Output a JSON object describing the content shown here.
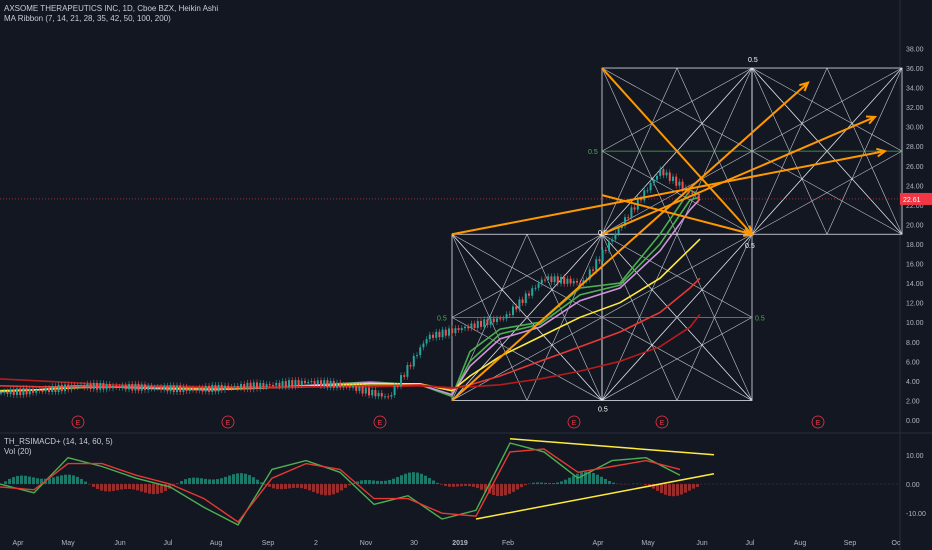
{
  "header": {
    "symbol_line": "AXSOME THERAPEUTICS INC, 1D, Cboe BZX, Heikin Ashi",
    "indicator_line": "MA Ribbon (7, 14, 21, 28, 35, 42, 50, 100, 200)"
  },
  "lower_pane": {
    "indicator_line": "TH_RSIMACD+ (14, 14, 60, 5)",
    "volume_line": "Vol (20)"
  },
  "chart_data": [
    {
      "type": "line",
      "title": "AXSOME THERAPEUTICS INC, 1D, Cboe BZX, Heikin Ashi",
      "chart_style": "candlestick (Heikin Ashi)",
      "scale": "linear",
      "grid": false,
      "background_color": "#131722",
      "ylim": [
        0,
        38
      ],
      "y_ticks": [
        "38.00",
        "36.00",
        "34.00",
        "32.00",
        "30.00",
        "28.00",
        "26.00",
        "24.00",
        "22.00",
        "20.00",
        "18.00",
        "16.00",
        "14.00",
        "12.00",
        "10.00",
        "8.00",
        "6.00",
        "4.00",
        "2.00",
        "0.00"
      ],
      "x_ticks": [
        "Apr",
        "May",
        "Jun",
        "Jul",
        "Aug",
        "Sep",
        "2",
        "Nov",
        "30",
        "2019",
        "Feb",
        "Apr",
        "May",
        "Jun",
        "Jul",
        "Aug",
        "Sep",
        "Oc"
      ],
      "last_price": {
        "label": "22.61",
        "value": 22.61,
        "color": "#f23645"
      },
      "earnings_markers": {
        "label": "E",
        "x": [
          "May",
          "Aug",
          "Nov",
          "Apr",
          "May",
          "Sep"
        ]
      },
      "price_path": [
        {
          "x": "Mar",
          "y": 2.8
        },
        {
          "x": "Apr",
          "y": 3.0
        },
        {
          "x": "May",
          "y": 3.5
        },
        {
          "x": "Jun",
          "y": 3.4
        },
        {
          "x": "Jul",
          "y": 3.3
        },
        {
          "x": "Aug",
          "y": 3.1
        },
        {
          "x": "Sep",
          "y": 3.4
        },
        {
          "x": "Oct",
          "y": 3.6
        },
        {
          "x": "Nov",
          "y": 3.9
        },
        {
          "x": "Dec",
          "y": 3.4
        },
        {
          "x": "2019",
          "y": 2.3
        },
        {
          "x": "Jan",
          "y": 8.5
        },
        {
          "x": "Feb",
          "y": 9.5
        },
        {
          "x": "Mar",
          "y": 10.5
        },
        {
          "x": "Mar",
          "y": 14.5
        },
        {
          "x": "Apr",
          "y": 14.0
        },
        {
          "x": "May",
          "y": 20.0
        },
        {
          "x": "May",
          "y": 25.5
        },
        {
          "x": "Jun",
          "y": 22.6
        }
      ],
      "series": [
        {
          "period": 7,
          "color": "#4caf50",
          "values": [
            2.9,
            3.1,
            3.5,
            3.4,
            3.2,
            3.1,
            3.3,
            3.6,
            3.9,
            3.6,
            2.4,
            7.0,
            9.3,
            10.0,
            13.5,
            14.0,
            19.0,
            23.5,
            23.0
          ]
        },
        {
          "period": 14,
          "color": "#4caf50",
          "values": [
            2.9,
            3.1,
            3.5,
            3.4,
            3.2,
            3.1,
            3.3,
            3.6,
            3.8,
            3.6,
            2.5,
            6.0,
            8.8,
            9.8,
            12.8,
            13.8,
            18.0,
            22.5,
            22.8
          ]
        },
        {
          "period": 21,
          "color": "#ce93d8",
          "values": [
            2.9,
            3.1,
            3.4,
            3.4,
            3.2,
            3.1,
            3.3,
            3.6,
            3.8,
            3.6,
            2.6,
            5.5,
            8.3,
            9.5,
            12.2,
            13.5,
            17.3,
            21.5,
            22.6
          ]
        },
        {
          "period": 50,
          "color": "#ffeb3b",
          "values": [
            3.0,
            3.1,
            3.3,
            3.4,
            3.3,
            3.2,
            3.3,
            3.5,
            3.7,
            3.7,
            3.0,
            4.5,
            6.5,
            8.5,
            10.5,
            12.0,
            14.5,
            17.5,
            18.5
          ]
        },
        {
          "period": 100,
          "color": "#e53935",
          "values": [
            3.5,
            3.4,
            3.4,
            3.4,
            3.4,
            3.3,
            3.3,
            3.4,
            3.5,
            3.6,
            3.2,
            3.6,
            4.5,
            6.0,
            7.5,
            9.0,
            11.0,
            13.5,
            14.5
          ]
        },
        {
          "period": 200,
          "color": "#b71c1c",
          "values": [
            4.2,
            4.0,
            3.8,
            3.6,
            3.5,
            3.4,
            3.4,
            3.4,
            3.4,
            3.5,
            3.3,
            3.4,
            3.6,
            4.2,
            5.0,
            6.0,
            7.5,
            9.5,
            10.8
          ]
        }
      ],
      "annotations": {
        "grid_midline_label": "0.5",
        "lower_box_price_range": [
          2.0,
          19.0
        ],
        "upper_box_price_range": [
          19.0,
          36.0
        ],
        "midlines": [
          10.5,
          27.5
        ],
        "arrow_color": "#ff9800"
      }
    },
    {
      "type": "bar",
      "title": "TH_RSIMACD+ (14, 14, 60, 5)",
      "ylim": [
        -14,
        15
      ],
      "y_ticks": [
        "10.00",
        "0.00",
        "-10.00"
      ],
      "series": [
        {
          "line": "fast",
          "color": "#4caf50",
          "values": [
            0,
            -3,
            9,
            6,
            2,
            -1,
            -8,
            -14,
            5,
            8,
            4,
            -7,
            -4,
            -12,
            -9,
            14,
            11,
            2,
            8,
            9,
            3
          ]
        },
        {
          "line": "slow",
          "color": "#e53935",
          "values": [
            -1,
            -2,
            7,
            7,
            3,
            0,
            -5,
            -13,
            2,
            7,
            5,
            -5,
            -5,
            -10,
            -11,
            11,
            12,
            4,
            6,
            8,
            5
          ]
        }
      ],
      "trendlines": [
        {
          "color": "#ffeb3b",
          "from": [
            15,
            15.5
          ],
          "to": [
            21,
            10
          ]
        },
        {
          "color": "#ffeb3b",
          "from": [
            14,
            -12
          ],
          "to": [
            21,
            3.5
          ]
        }
      ]
    }
  ]
}
